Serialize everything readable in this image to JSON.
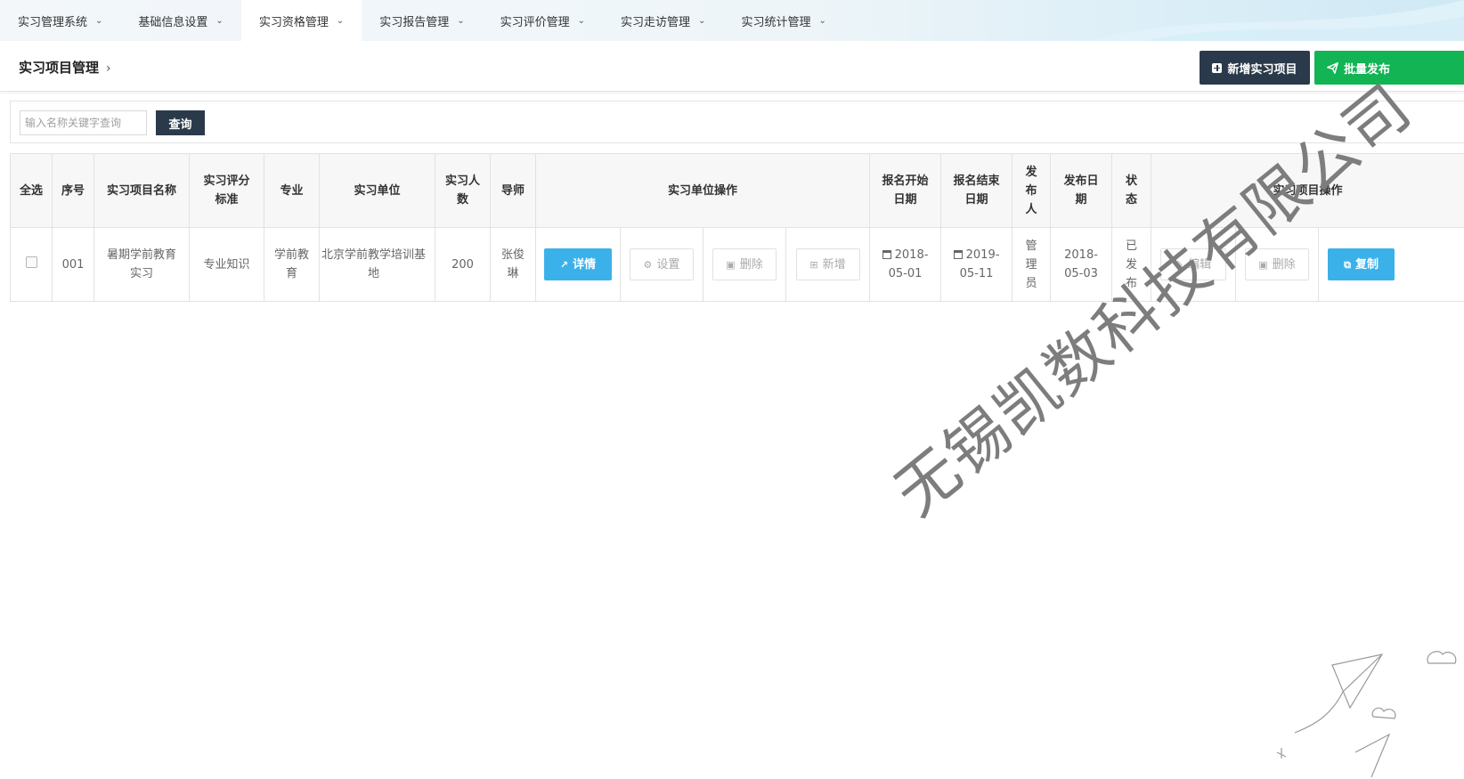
{
  "nav": {
    "items": [
      {
        "label": "实习管理系统"
      },
      {
        "label": "基础信息设置"
      },
      {
        "label": "实习资格管理"
      },
      {
        "label": "实习报告管理"
      },
      {
        "label": "实习评价管理"
      },
      {
        "label": "实习走访管理"
      },
      {
        "label": "实习统计管理"
      }
    ],
    "active_index": 2
  },
  "header": {
    "title": "实习项目管理",
    "breadcrumb_arrow": "›",
    "add_button": "新增实习项目",
    "publish_button": "批量发布"
  },
  "search": {
    "placeholder": "输入名称关键字查询",
    "button": "查询"
  },
  "table": {
    "headers": {
      "select_all": "全选",
      "index": "序号",
      "name": "实习项目名称",
      "score_standard": "实习评分标准",
      "major": "专业",
      "unit": "实习单位",
      "count": "实习人数",
      "mentor": "导师",
      "unit_ops": "实习单位操作",
      "signup_start": "报名开始日期",
      "signup_end": "报名结束日期",
      "publisher": "发布人",
      "publish_date": "发布日期",
      "status": "状态",
      "project_ops": "实习项目操作"
    },
    "rows": [
      {
        "index": "001",
        "name": "暑期学前教育实习",
        "score_standard": "专业知识",
        "major": "学前教育",
        "unit": "北京学前教学培训基地",
        "count": "200",
        "mentor": "张俊琳",
        "unit_ops": {
          "detail": "详情",
          "settings": "设置",
          "delete": "删除",
          "add": "新增"
        },
        "signup_start": "2018-05-01",
        "signup_end": "2019-05-11",
        "publisher": "管理员",
        "publish_date": "2018-05-03",
        "status": "已发布",
        "project_ops": {
          "edit": "编辑",
          "delete": "删除",
          "copy": "复制"
        }
      }
    ]
  },
  "watermark": "无锡凯数科技有限公司",
  "colors": {
    "dark": "#2b3a4a",
    "green": "#12b454",
    "blue": "#3bb1ea",
    "date_start": "#2e8b1e",
    "date_end": "#e24545"
  }
}
